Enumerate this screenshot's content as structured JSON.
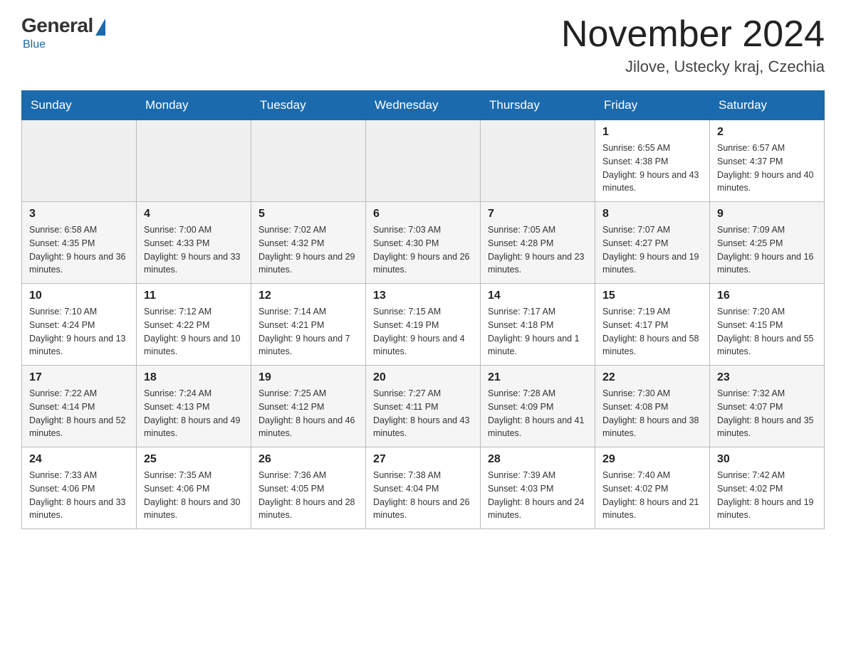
{
  "header": {
    "logo_general": "General",
    "logo_blue": "Blue",
    "title": "November 2024",
    "subtitle": "Jilove, Ustecky kraj, Czechia"
  },
  "days_of_week": [
    "Sunday",
    "Monday",
    "Tuesday",
    "Wednesday",
    "Thursday",
    "Friday",
    "Saturday"
  ],
  "weeks": [
    [
      {
        "day": "",
        "info": ""
      },
      {
        "day": "",
        "info": ""
      },
      {
        "day": "",
        "info": ""
      },
      {
        "day": "",
        "info": ""
      },
      {
        "day": "",
        "info": ""
      },
      {
        "day": "1",
        "info": "Sunrise: 6:55 AM\nSunset: 4:38 PM\nDaylight: 9 hours and 43 minutes."
      },
      {
        "day": "2",
        "info": "Sunrise: 6:57 AM\nSunset: 4:37 PM\nDaylight: 9 hours and 40 minutes."
      }
    ],
    [
      {
        "day": "3",
        "info": "Sunrise: 6:58 AM\nSunset: 4:35 PM\nDaylight: 9 hours and 36 minutes."
      },
      {
        "day": "4",
        "info": "Sunrise: 7:00 AM\nSunset: 4:33 PM\nDaylight: 9 hours and 33 minutes."
      },
      {
        "day": "5",
        "info": "Sunrise: 7:02 AM\nSunset: 4:32 PM\nDaylight: 9 hours and 29 minutes."
      },
      {
        "day": "6",
        "info": "Sunrise: 7:03 AM\nSunset: 4:30 PM\nDaylight: 9 hours and 26 minutes."
      },
      {
        "day": "7",
        "info": "Sunrise: 7:05 AM\nSunset: 4:28 PM\nDaylight: 9 hours and 23 minutes."
      },
      {
        "day": "8",
        "info": "Sunrise: 7:07 AM\nSunset: 4:27 PM\nDaylight: 9 hours and 19 minutes."
      },
      {
        "day": "9",
        "info": "Sunrise: 7:09 AM\nSunset: 4:25 PM\nDaylight: 9 hours and 16 minutes."
      }
    ],
    [
      {
        "day": "10",
        "info": "Sunrise: 7:10 AM\nSunset: 4:24 PM\nDaylight: 9 hours and 13 minutes."
      },
      {
        "day": "11",
        "info": "Sunrise: 7:12 AM\nSunset: 4:22 PM\nDaylight: 9 hours and 10 minutes."
      },
      {
        "day": "12",
        "info": "Sunrise: 7:14 AM\nSunset: 4:21 PM\nDaylight: 9 hours and 7 minutes."
      },
      {
        "day": "13",
        "info": "Sunrise: 7:15 AM\nSunset: 4:19 PM\nDaylight: 9 hours and 4 minutes."
      },
      {
        "day": "14",
        "info": "Sunrise: 7:17 AM\nSunset: 4:18 PM\nDaylight: 9 hours and 1 minute."
      },
      {
        "day": "15",
        "info": "Sunrise: 7:19 AM\nSunset: 4:17 PM\nDaylight: 8 hours and 58 minutes."
      },
      {
        "day": "16",
        "info": "Sunrise: 7:20 AM\nSunset: 4:15 PM\nDaylight: 8 hours and 55 minutes."
      }
    ],
    [
      {
        "day": "17",
        "info": "Sunrise: 7:22 AM\nSunset: 4:14 PM\nDaylight: 8 hours and 52 minutes."
      },
      {
        "day": "18",
        "info": "Sunrise: 7:24 AM\nSunset: 4:13 PM\nDaylight: 8 hours and 49 minutes."
      },
      {
        "day": "19",
        "info": "Sunrise: 7:25 AM\nSunset: 4:12 PM\nDaylight: 8 hours and 46 minutes."
      },
      {
        "day": "20",
        "info": "Sunrise: 7:27 AM\nSunset: 4:11 PM\nDaylight: 8 hours and 43 minutes."
      },
      {
        "day": "21",
        "info": "Sunrise: 7:28 AM\nSunset: 4:09 PM\nDaylight: 8 hours and 41 minutes."
      },
      {
        "day": "22",
        "info": "Sunrise: 7:30 AM\nSunset: 4:08 PM\nDaylight: 8 hours and 38 minutes."
      },
      {
        "day": "23",
        "info": "Sunrise: 7:32 AM\nSunset: 4:07 PM\nDaylight: 8 hours and 35 minutes."
      }
    ],
    [
      {
        "day": "24",
        "info": "Sunrise: 7:33 AM\nSunset: 4:06 PM\nDaylight: 8 hours and 33 minutes."
      },
      {
        "day": "25",
        "info": "Sunrise: 7:35 AM\nSunset: 4:06 PM\nDaylight: 8 hours and 30 minutes."
      },
      {
        "day": "26",
        "info": "Sunrise: 7:36 AM\nSunset: 4:05 PM\nDaylight: 8 hours and 28 minutes."
      },
      {
        "day": "27",
        "info": "Sunrise: 7:38 AM\nSunset: 4:04 PM\nDaylight: 8 hours and 26 minutes."
      },
      {
        "day": "28",
        "info": "Sunrise: 7:39 AM\nSunset: 4:03 PM\nDaylight: 8 hours and 24 minutes."
      },
      {
        "day": "29",
        "info": "Sunrise: 7:40 AM\nSunset: 4:02 PM\nDaylight: 8 hours and 21 minutes."
      },
      {
        "day": "30",
        "info": "Sunrise: 7:42 AM\nSunset: 4:02 PM\nDaylight: 8 hours and 19 minutes."
      }
    ]
  ]
}
